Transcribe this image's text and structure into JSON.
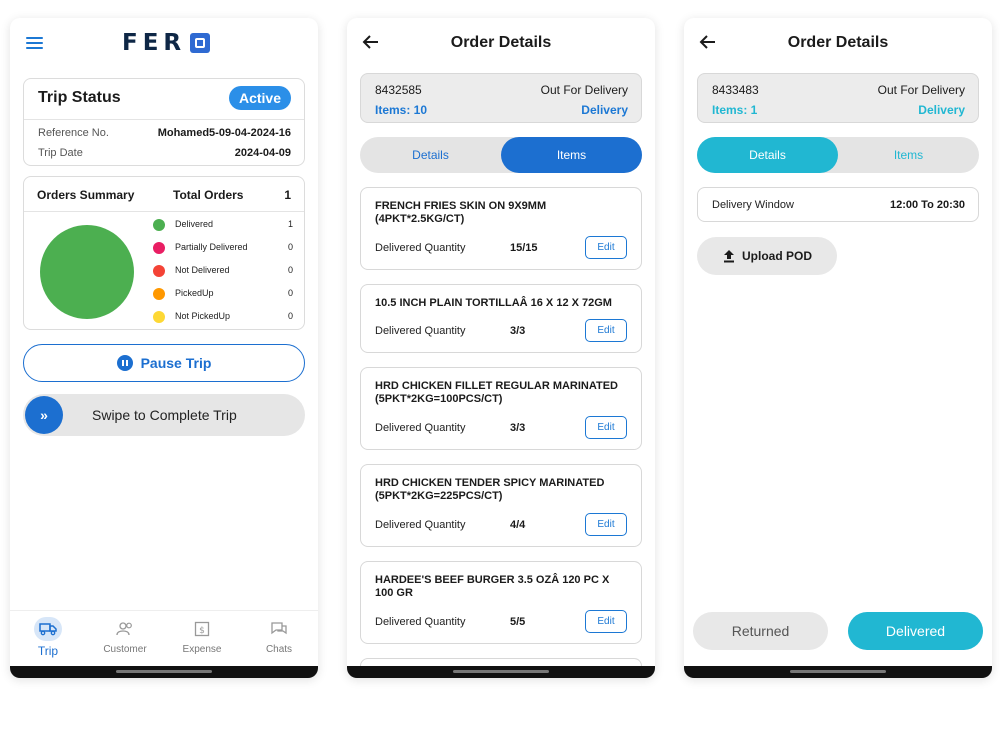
{
  "colors": {
    "primary_blue": "#1c6fd0",
    "teal": "#21b7d2",
    "delivered_green": "#4caf50"
  },
  "trip_screen": {
    "logo_text": "FER",
    "trip_status": {
      "title": "Trip Status",
      "badge": "Active",
      "ref_label": "Reference No.",
      "ref_value": "Mohamed5-09-04-2024-16",
      "date_label": "Trip Date",
      "date_value": "2024-04-09"
    },
    "orders_summary": {
      "title": "Orders Summary",
      "total_label": "Total Orders",
      "total_value": "1",
      "legend": [
        {
          "label": "Delivered",
          "value": "1",
          "color": "#4caf50"
        },
        {
          "label": "Partially Delivered",
          "value": "0",
          "color": "#e91e63"
        },
        {
          "label": "Not Delivered",
          "value": "0",
          "color": "#f44336"
        },
        {
          "label": "PickedUp",
          "value": "0",
          "color": "#ff9800"
        },
        {
          "label": "Not PickedUp",
          "value": "0",
          "color": "#fdd835"
        }
      ]
    },
    "pause_label": "Pause Trip",
    "swipe_label": "Swipe to Complete Trip",
    "swipe_knob": "»",
    "nav": [
      {
        "label": "Trip",
        "icon": "truck-icon"
      },
      {
        "label": "Customer",
        "icon": "users-icon"
      },
      {
        "label": "Expense",
        "icon": "receipt-icon"
      },
      {
        "label": "Chats",
        "icon": "chat-icon"
      }
    ]
  },
  "items_screen": {
    "title": "Order Details",
    "order": {
      "id": "8432585",
      "status": "Out For Delivery",
      "items": "Items: 10",
      "type": "Delivery"
    },
    "tabs": {
      "details": "Details",
      "items": "Items"
    },
    "items": [
      {
        "name": "FRENCH FRIES SKIN ON 9X9MM (4PKT*2.5KG/CT)",
        "qty_label": "Delivered Quantity",
        "qty": "15/15",
        "edit": "Edit"
      },
      {
        "name": "10.5 INCH PLAIN TORTILLAÂ 16 X 12 X 72GM",
        "qty_label": "Delivered Quantity",
        "qty": "3/3",
        "edit": "Edit"
      },
      {
        "name": "HRD CHICKEN FILLET REGULAR MARINATED (5PKT*2KG=100PCS/CT)",
        "qty_label": "Delivered Quantity",
        "qty": "3/3",
        "edit": "Edit"
      },
      {
        "name": "HRD CHICKEN TENDER SPICY MARINATED (5PKT*2KG=225PCS/CT)",
        "qty_label": "Delivered Quantity",
        "qty": "4/4",
        "edit": "Edit"
      },
      {
        "name": "HARDEE'S BEEF BURGER 3.5 OZÂ  120 PC X 100 GR",
        "qty_label": "Delivered Quantity",
        "qty": "5/5",
        "edit": "Edit"
      }
    ]
  },
  "details_screen": {
    "title": "Order Details",
    "order": {
      "id": "8433483",
      "status": "Out For Delivery",
      "items": "Items: 1",
      "type": "Delivery"
    },
    "tabs": {
      "details": "Details",
      "items": "Items"
    },
    "delivery_window": {
      "label": "Delivery Window",
      "value": "12:00 To 20:30"
    },
    "upload_label": "Upload POD",
    "returned_label": "Returned",
    "delivered_label": "Delivered"
  }
}
